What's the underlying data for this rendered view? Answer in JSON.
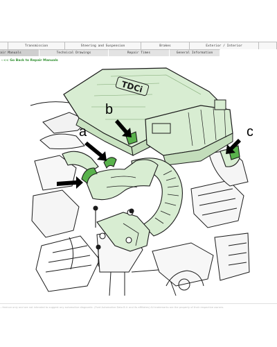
{
  "nav": {
    "top_tabs": [
      "Transmission",
      "Steering and Suspension",
      "Brakes",
      "Exterior / Interior"
    ],
    "sub_tabs": [
      "Repair Manuals",
      "Technical Drawings",
      "Repair Times",
      "General Information"
    ]
  },
  "back_link": "<< Go Back to Repair Manuals",
  "figure": {
    "callouts": [
      "a",
      "b",
      "c"
    ],
    "engine_cover_label": "TDCi"
  },
  "footer": "...ference only and are not intended to suggest any automotive diagnostic. (Ford Automotive Data B.V. and its affiliates) All trademarks are the property of their respective owners.",
  "colors": {
    "highlight": "#d8edd2",
    "line": "#1b1b1b",
    "link": "#2f8f2f"
  }
}
